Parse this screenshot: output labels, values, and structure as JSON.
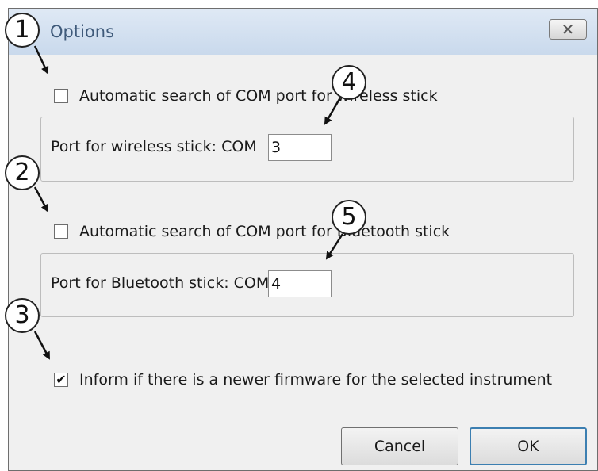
{
  "window": {
    "title": "Options",
    "close_glyph": "✕"
  },
  "wireless": {
    "auto_label": "Automatic search of COM port for wireless stick",
    "auto_checked": false,
    "port_label": "Port for wireless stick:  COM",
    "port_value": "3"
  },
  "bluetooth": {
    "auto_label": "Automatic search of COM port for Bluetooth stick",
    "auto_checked": false,
    "port_label": "Port for Bluetooth stick:  COM",
    "port_value": "4"
  },
  "firmware": {
    "label": "Inform if there is a newer firmware for the selected instrument",
    "checked": true,
    "check_glyph": "✔"
  },
  "buttons": {
    "cancel": "Cancel",
    "ok": "OK"
  },
  "callouts": [
    "1",
    "2",
    "3",
    "4",
    "5"
  ]
}
